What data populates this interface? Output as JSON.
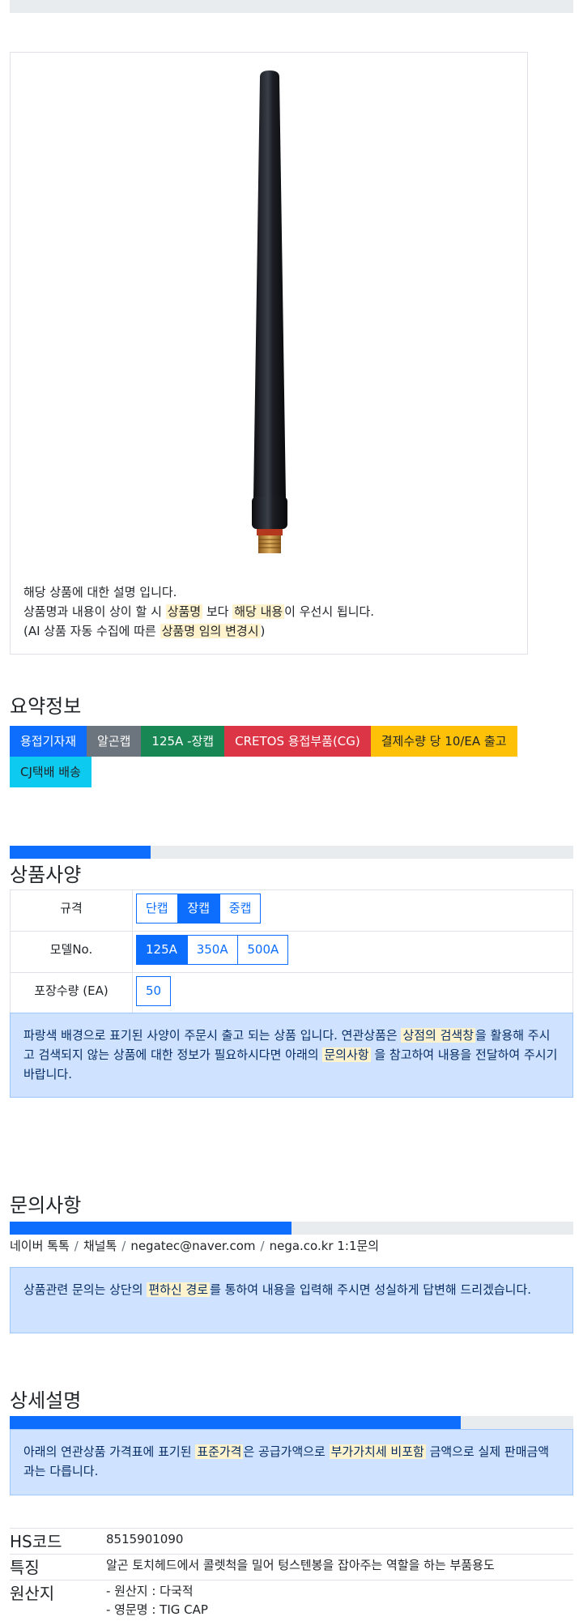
{
  "product": {
    "image_name": "tig-long-back-cap",
    "desc_line1": "해당 상품에 대한 설명 입니다.",
    "desc_line2_a": "상품명과 내용이 상이 할 시 ",
    "desc_line2_hl1": "상품명",
    "desc_line2_b": " 보다 ",
    "desc_line2_hl2": "해당 내용",
    "desc_line2_c": "이 우선시 됩니다.",
    "desc_line3_a": "(AI 상품 자동 수집에 따른 ",
    "desc_line3_hl": "상품명 임의 변경시",
    "desc_line3_b": ")"
  },
  "summary": {
    "title": "요약정보",
    "badges": [
      {
        "label": "용접기자재",
        "color": "#0d6efd"
      },
      {
        "label": "알곤캡",
        "color": "#6c757d"
      },
      {
        "label": "125A -장캡",
        "color": "#198754"
      },
      {
        "label": "CRETOS 용접부품(CG)",
        "color": "#dc3545"
      },
      {
        "label": "결제수량 당 10/EA 출고",
        "color": "#ffc107",
        "text_color": "#212529"
      },
      {
        "label": "CJ택배 배송",
        "color": "#0dcaf0",
        "text_color": "#212529"
      }
    ]
  },
  "spec": {
    "progress": 0.25,
    "title": "상품사양",
    "rows": [
      {
        "label": "규격",
        "options": [
          "단캡",
          "장캡",
          "중캡"
        ],
        "active": 1
      },
      {
        "label": "모델No.",
        "options": [
          "125A",
          "350A",
          "500A"
        ],
        "active": 0
      },
      {
        "label": "포장수량 (EA)",
        "options": [
          "50"
        ],
        "active": -1
      }
    ],
    "notice_a": "파랑색 배경으로 표기된 사양이 주문시 출고 되는 상품 입니다. 연관상품은 ",
    "notice_hl1": "상점의 검색창",
    "notice_b": "을 활용해 주시고 검색되지 않는 상품에 대한 정보가 필요하시다면 아래의 ",
    "notice_hl2": "문의사항",
    "notice_c": " 을 참고하여 내용을 전달하여 주시기 바랍니다."
  },
  "inquiry": {
    "title": "문의사항",
    "progress": 0.5,
    "contacts": [
      "네이버 톡톡",
      "채널톡",
      "negatec@naver.com",
      "nega.co.kr 1:1문의"
    ],
    "separator": "/",
    "notice_a": "상품관련 문의는 상단의 ",
    "notice_hl": "편하신 경로",
    "notice_b": "를 통하여 내용을 입력해 주시면 성실하게 답변해 드리겠습니다."
  },
  "detail": {
    "title": "상세설명",
    "progress": 0.8,
    "notice_a": "아래의 연관상품 가격표에 표기된 ",
    "notice_hl1": "표준가격",
    "notice_b": "은 공급가액으로 ",
    "notice_hl2": "부가가치세 비포함",
    "notice_c": " 금액으로 실제 판매금액과는 다릅니다.",
    "rows": [
      {
        "key": "HS코드",
        "value": "8515901090"
      },
      {
        "key": "특징",
        "value": "알곤 토치헤드에서 콜렛척을 밀어 텅스텐봉을 잡아주는 역할을 하는 부품용도"
      },
      {
        "key": "원산지",
        "value1": "- 원산지 : 다국적",
        "value2": "- 영문명 : TIG CAP"
      }
    ]
  }
}
